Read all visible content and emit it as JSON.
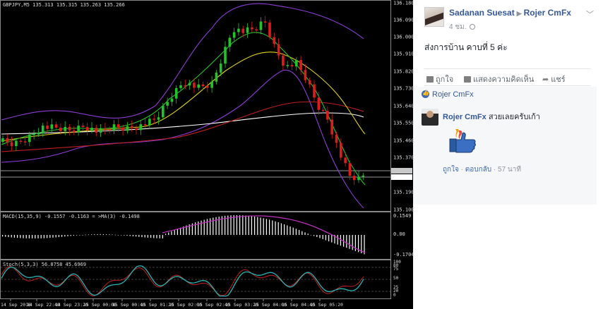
{
  "chart": {
    "symbol_header": "GBPJPY,M5  135.313 135.315 135.263 135.266",
    "price_axis": [
      "136.180",
      "136.090",
      "136.000",
      "135.910",
      "135.820",
      "135.730",
      "135.640",
      "135.550",
      "135.460",
      "135.370",
      "135.302",
      "135.266",
      "135.190",
      "135.100"
    ],
    "macd_label": "MACD(15,35,9) -0.1557 -0.1163 = >MA(3) -0.1498",
    "macd_axis": [
      "0.1549",
      "0.00",
      "-0.1704"
    ],
    "stoch_label": "Stoch(5,3,3) 56.8758 45.6969",
    "stoch_axis": [
      "100",
      "80",
      "75",
      "50",
      "25",
      "20",
      "0"
    ],
    "time_axis": [
      "14 Sep 2016",
      "14 Sep 22:40",
      "14 Sep 23:20",
      "15 Sep 00:00",
      "15 Sep 00:40",
      "15 Sep 01:20",
      "15 Sep 02:00",
      "15 Sep 02:40",
      "15 Sep 03:20",
      "15 Sep 04:00",
      "15 Sep 04:40",
      "15 Sep 05:20"
    ],
    "colors": {
      "bull": "#22c32b",
      "bear": "#e01b1b",
      "bb": "#8b3dd4",
      "ema_fast": "#22c32b",
      "ema_mid": "#e0d21b",
      "ema_slow": "#c01f1f",
      "ema_long": "#ffffff",
      "macd_hist": "#ffffff",
      "macd_signal": "#c02ec0",
      "stoch_main": "#2bb3b3",
      "stoch_signal": "#c01f1f"
    }
  },
  "post": {
    "author": "Sadanan Suesat",
    "target": "Rojer CmFx",
    "time": "4 ชม.",
    "text": "ส่งการบ้าน คาบที่ 5 ค่ะ",
    "actions": {
      "like": "ถูกใจ",
      "comment": "แสดงความคิดเห็น",
      "share": "แชร์"
    },
    "liked_by": "Rojer CmFx",
    "comment": {
      "author": "Rojer CmFx",
      "text": "สวยเลยครับเก้า",
      "like": "ถูกใจ",
      "reply": "ตอบกลับ",
      "time": "57 นาที"
    }
  }
}
